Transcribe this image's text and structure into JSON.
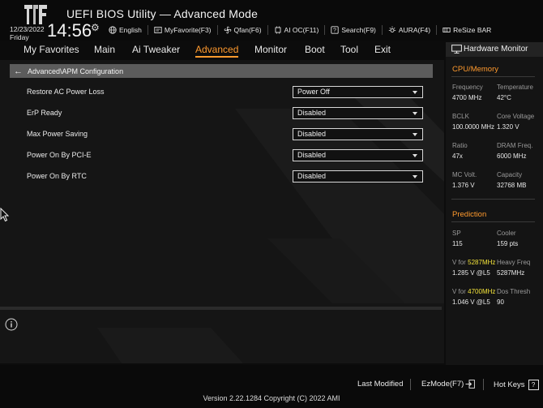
{
  "header": {
    "title": "UEFI BIOS Utility — Advanced Mode",
    "date": "12/23/2022",
    "day": "Friday",
    "time": "14:56"
  },
  "toolbar": [
    {
      "icon": "globe-icon",
      "label": "English"
    },
    {
      "icon": "favorite-icon",
      "label": "MyFavorite(F3)"
    },
    {
      "icon": "fan-icon",
      "label": "Qfan(F6)"
    },
    {
      "icon": "ai-oc-icon",
      "label": "AI OC(F11)"
    },
    {
      "icon": "help-search-icon",
      "label": "Search(F9)"
    },
    {
      "icon": "aura-icon",
      "label": "AURA(F4)"
    },
    {
      "icon": "resize-bar-icon",
      "label": "ReSize BAR"
    }
  ],
  "nav": {
    "tabs": [
      "My Favorites",
      "Main",
      "Ai Tweaker",
      "Advanced",
      "Monitor",
      "Boot",
      "Tool",
      "Exit"
    ],
    "active": "Advanced"
  },
  "breadcrumb": "Advanced\\APM Configuration",
  "settings": [
    {
      "label": "Restore AC Power Loss",
      "value": "Power Off"
    },
    {
      "label": "ErP Ready",
      "value": "Disabled"
    },
    {
      "label": "Max Power Saving",
      "value": "Disabled"
    },
    {
      "label": "Power On By PCI-E",
      "value": "Disabled"
    },
    {
      "label": "Power On By RTC",
      "value": "Disabled"
    }
  ],
  "hardware_monitor": {
    "title": "Hardware Monitor",
    "cpu_section": "CPU/Memory",
    "cpu": [
      {
        "k1": "Frequency",
        "v1": "4700 MHz",
        "k2": "Temperature",
        "v2": "42°C"
      },
      {
        "k1": "BCLK",
        "v1": "100.0000 MHz",
        "k2": "Core Voltage",
        "v2": "1.320 V"
      },
      {
        "k1": "Ratio",
        "v1": "47x",
        "k2": "DRAM Freq.",
        "v2": "6000 MHz"
      },
      {
        "k1": "MC Volt.",
        "v1": "1.376 V",
        "k2": "Capacity",
        "v2": "32768 MB"
      }
    ],
    "prediction_section": "Prediction",
    "sp_label": "SP",
    "sp_value": "115",
    "cooler_label": "Cooler",
    "cooler_value": "159 pts",
    "vfor_label": "V for",
    "freq1": "5287MHz",
    "freq1_volt": "1.285 V @L5",
    "heavy_freq_label": "Heavy Freq",
    "heavy_freq_value": "5287MHz",
    "freq2": "4700MHz",
    "freq2_volt": "1.046 V @L5",
    "dos_thresh_label": "Dos Thresh",
    "dos_thresh_value": "90"
  },
  "footer": {
    "last_modified": "Last Modified",
    "ezmode": "EzMode(F7)",
    "hotkeys": "Hot Keys",
    "hotkeys_key": "?",
    "version": "Version 2.22.1284 Copyright (C) 2022 AMI"
  },
  "colors": {
    "accent": "#ff9a2e",
    "highlight": "#f2e23a",
    "background": "#0c0c0c"
  }
}
